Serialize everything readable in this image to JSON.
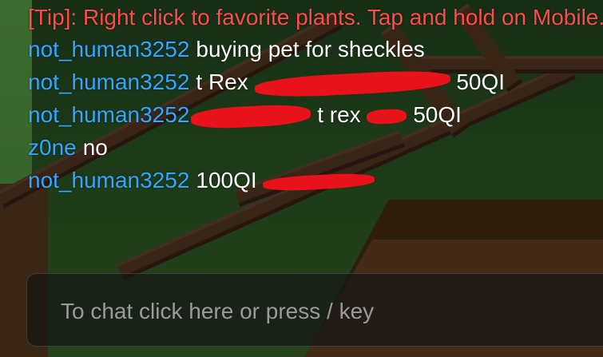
{
  "chat": {
    "tip": "[Tip]: Right click to favorite plants. Tap and hold on Mobile.",
    "messages": [
      {
        "user": "not_human3252",
        "text": "buying pet for sheckles"
      },
      {
        "user": "not_human3252",
        "text_before": "t Rex",
        "text_after": "50QI"
      },
      {
        "user": "not_human3252",
        "text_mid": "t rex",
        "text_after": "50QI"
      },
      {
        "user": "z0ne",
        "text": "no"
      },
      {
        "user": "not_human3252",
        "text": "100QI"
      }
    ],
    "input": {
      "placeholder": "To chat click here or press / key",
      "value": ""
    }
  },
  "colors": {
    "username": "#35a6ff",
    "tip": "#ff4b4b",
    "redaction": "#e8121b"
  }
}
